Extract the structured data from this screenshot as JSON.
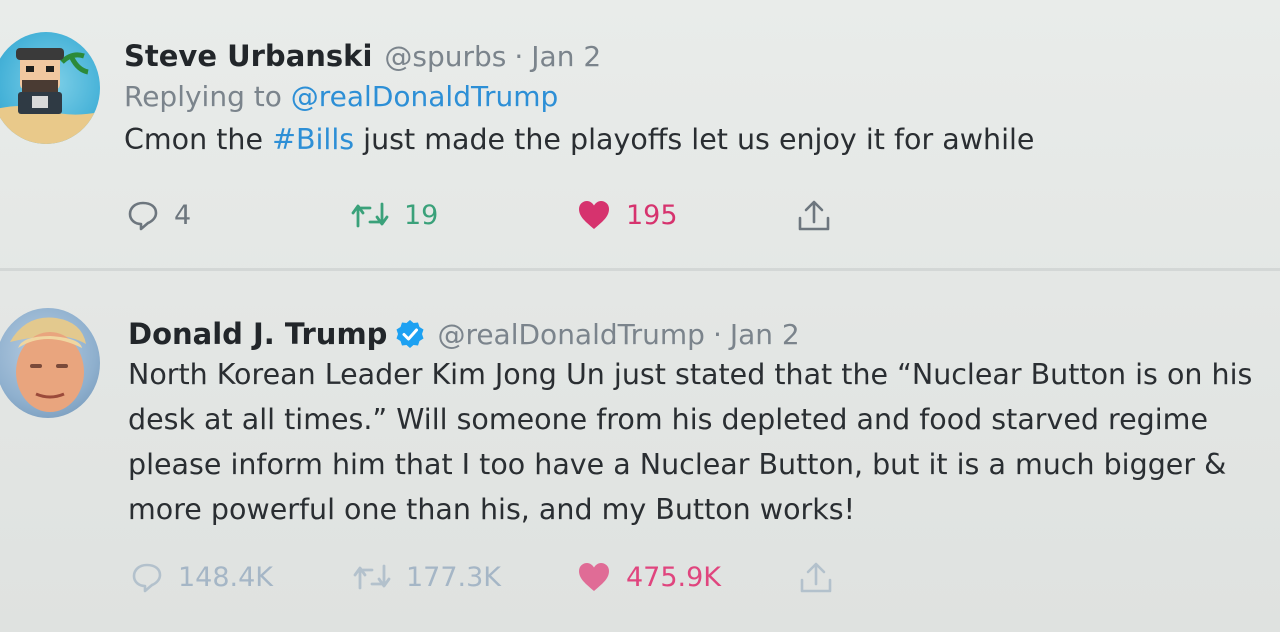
{
  "tweets": [
    {
      "name": "Steve Urbanski",
      "handle": "@spurbs",
      "separator": "·",
      "date": "Jan 2",
      "reply_prefix": "Replying to",
      "reply_to": "@realDonaldTrump",
      "text_before": "Cmon the",
      "hashtag": "#Bills",
      "text_after": "just made the playoffs let us enjoy it for awhile",
      "replies": "4",
      "retweets": "19",
      "likes": "195",
      "liked": true,
      "icons": [
        "reply-icon",
        "retweet-icon",
        "heart-icon",
        "share-icon"
      ]
    },
    {
      "name": "Donald J. Trump",
      "verified": true,
      "handle": "@realDonaldTrump",
      "separator": "·",
      "date": "Jan 2",
      "text": "North Korean Leader Kim Jong Un just stated that the “Nuclear Button is on his desk at all times.” Will someone from his depleted and food starved regime please inform him that I too have a Nuclear Button, but it is a much bigger & more powerful one than his, and my Button works!",
      "replies": "148.4K",
      "retweets": "177.3K",
      "likes": "475.9K",
      "liked": true,
      "icons": [
        "reply-icon",
        "retweet-icon",
        "heart-icon",
        "share-icon"
      ]
    }
  ],
  "colors": {
    "link": "#2d8fd6",
    "retweet": "#3aa17a",
    "like": "#d6336e",
    "verified": "#1da1f2"
  }
}
